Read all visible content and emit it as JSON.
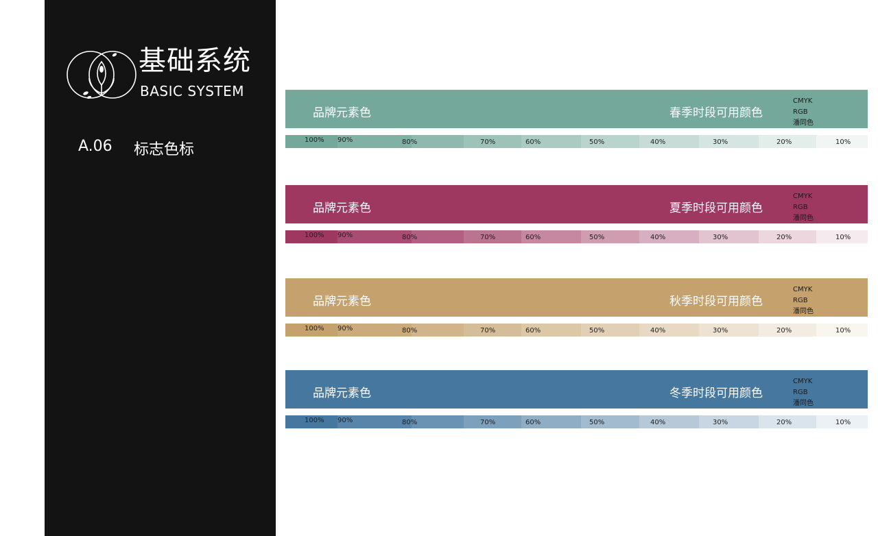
{
  "header": {
    "title_cn": "基础系统",
    "title_en": "BASIC SYSTEM",
    "section_number": "A.06",
    "section_title": "标志色标"
  },
  "palettes": [
    {
      "brand_label": "品牌元素色",
      "season_label": "春季时段可用颜色",
      "codes": [
        "CMYK",
        "RGB",
        "潘同色"
      ],
      "color": "#73a89a",
      "tints": [
        "100%",
        "90%",
        "80%",
        "70%",
        "60%",
        "50%",
        "40%",
        "30%",
        "20%",
        "10%"
      ]
    },
    {
      "brand_label": "品牌元素色",
      "season_label": "夏季时段可用颜色",
      "codes": [
        "CMYK",
        "RGB",
        "潘同色"
      ],
      "color": "#9e3861",
      "tints": [
        "100%",
        "90%",
        "80%",
        "70%",
        "60%",
        "50%",
        "40%",
        "30%",
        "20%",
        "10%"
      ]
    },
    {
      "brand_label": "品牌元素色",
      "season_label": "秋季时段可用颜色",
      "codes": [
        "CMYK",
        "RGB",
        "潘同色"
      ],
      "color": "#c5a16d",
      "tints": [
        "100%",
        "90%",
        "80%",
        "70%",
        "60%",
        "50%",
        "40%",
        "30%",
        "20%",
        "10%"
      ]
    },
    {
      "brand_label": "品牌元素色",
      "season_label": "冬季时段可用颜色",
      "codes": [
        "CMYK",
        "RGB",
        "潘同色"
      ],
      "color": "#45779f",
      "tints": [
        "100%",
        "90%",
        "80%",
        "70%",
        "60%",
        "50%",
        "40%",
        "30%",
        "20%",
        "10%"
      ]
    }
  ]
}
